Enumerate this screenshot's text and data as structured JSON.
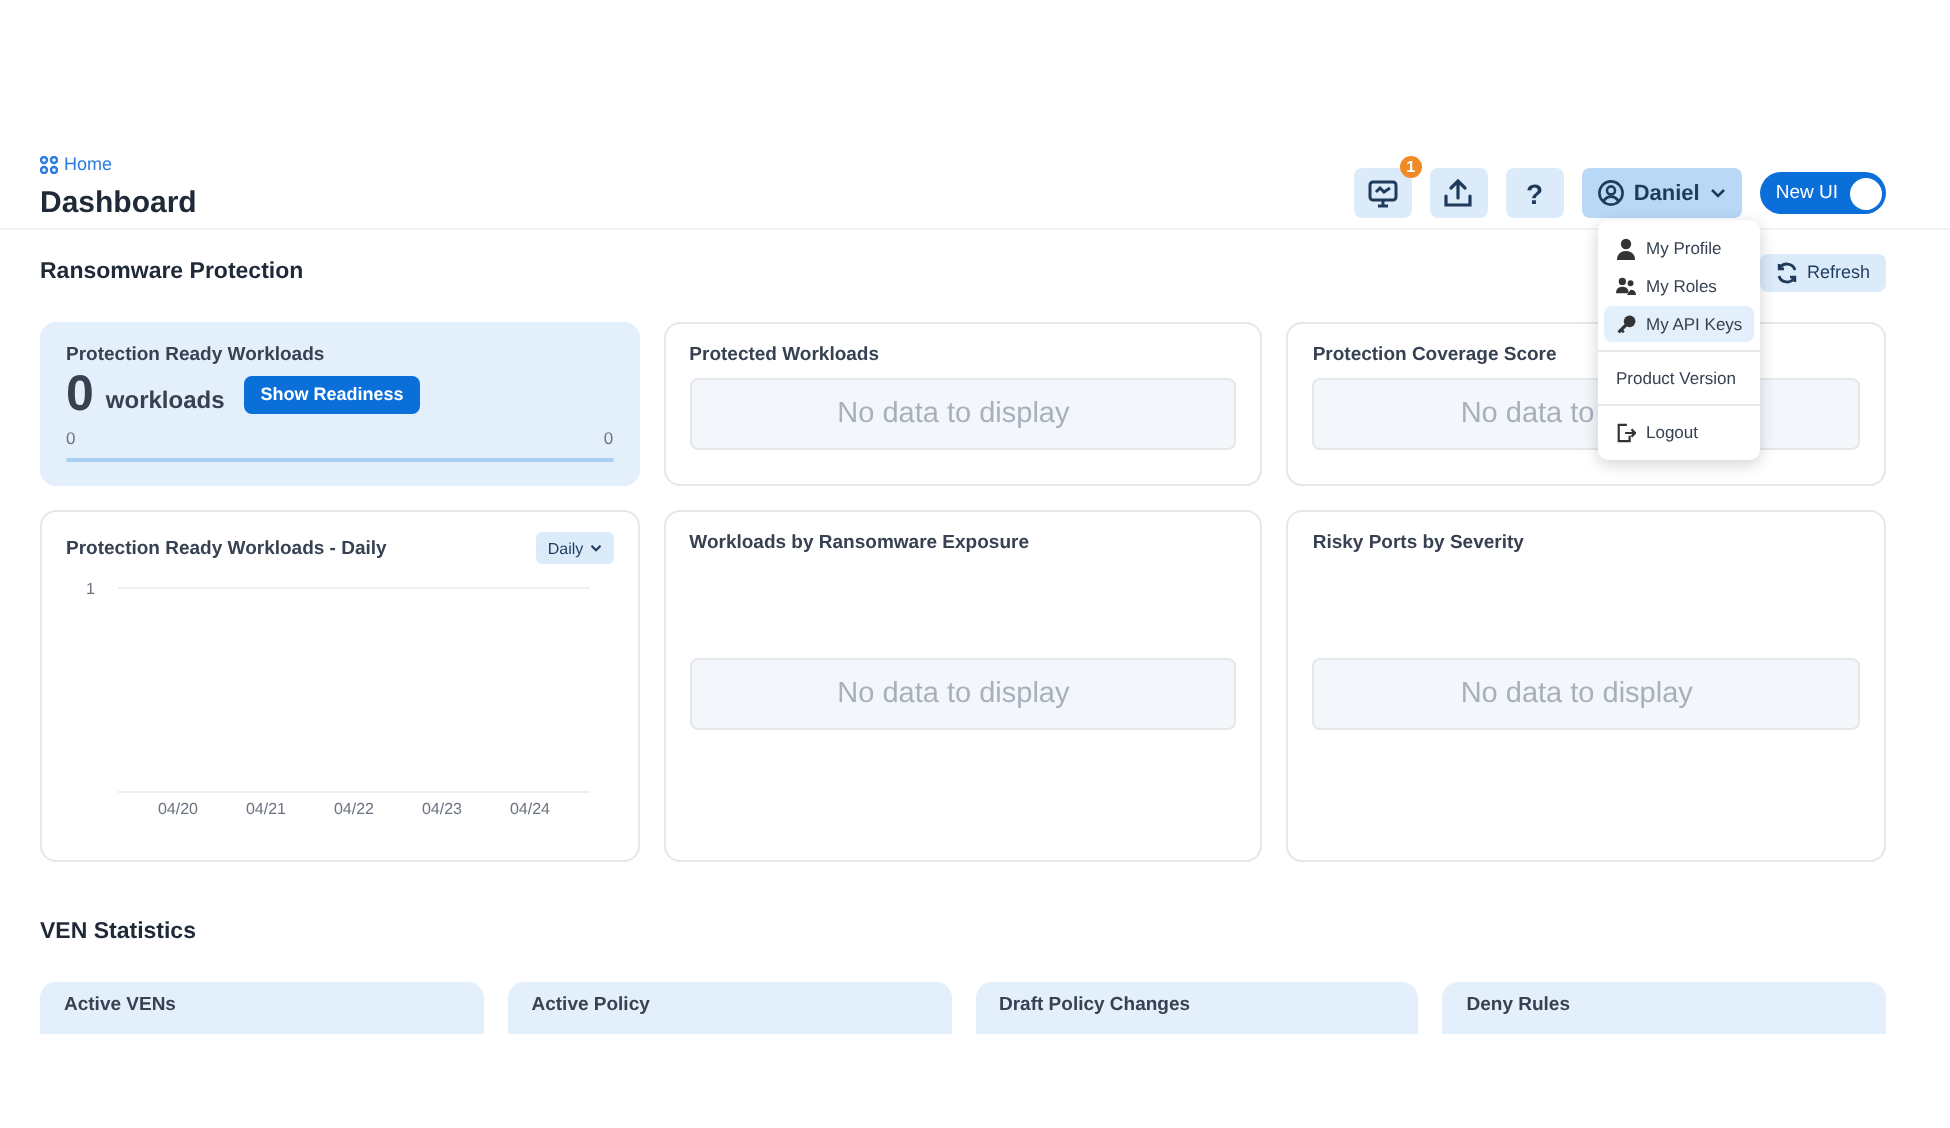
{
  "breadcrumb": {
    "label": "Home"
  },
  "page_title": "Dashboard",
  "header": {
    "notifications_badge": "1",
    "help_button": "?",
    "user": {
      "name": "Daniel",
      "expanded": true
    },
    "new_ui_toggle": {
      "label": "New UI",
      "on": true
    }
  },
  "user_menu": {
    "items": [
      {
        "label": "My Profile",
        "kind": "icon",
        "selected": false
      },
      {
        "label": "My Roles",
        "kind": "icon",
        "selected": false
      },
      {
        "label": "My API Keys",
        "kind": "icon",
        "selected": true
      },
      {
        "label": "Product Version",
        "kind": "plain",
        "selected": false
      },
      {
        "label": "Logout",
        "kind": "icon",
        "selected": false
      }
    ]
  },
  "ransomware": {
    "title": "Ransomware Protection",
    "refresh_button": "Refresh",
    "cards": [
      {
        "kind": "summary",
        "title": "Protection Ready Workloads",
        "value": "0",
        "unit": "workloads",
        "button": "Show Readiness",
        "range_min": "0",
        "range_max": "0"
      },
      {
        "kind": "empty",
        "title": "Protected Workloads",
        "message": "No data to display"
      },
      {
        "kind": "empty",
        "title": "Protection Coverage Score",
        "message": "No data to"
      },
      {
        "kind": "chart",
        "title": "Protection Ready Workloads - Daily",
        "dropdown": "Daily",
        "y_axis_label": "1",
        "x_axis_labels": [
          "04/20",
          "04/21",
          "04/22",
          "04/23",
          "04/24"
        ]
      },
      {
        "kind": "empty",
        "title": "Workloads by Ransomware Exposure",
        "message": "No data to display"
      },
      {
        "kind": "empty",
        "title": "Risky Ports by Severity",
        "message": "No data to display"
      }
    ]
  },
  "ven_statistics": {
    "title": "VEN Statistics",
    "cards": [
      {
        "title": "Active VENs"
      },
      {
        "title": "Active Policy"
      },
      {
        "title": "Draft Policy Changes"
      },
      {
        "title": "Deny Rules"
      }
    ]
  }
}
